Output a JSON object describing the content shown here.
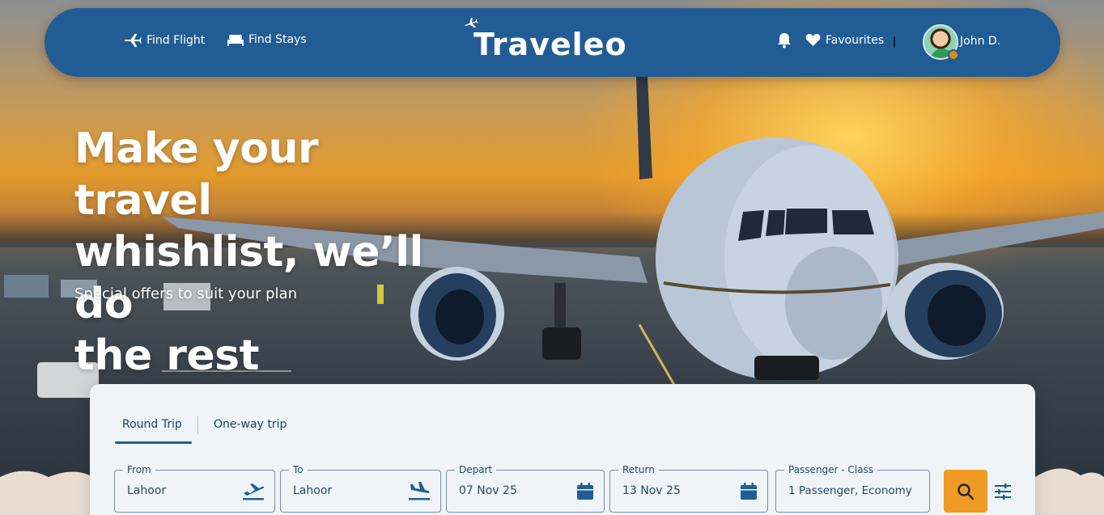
{
  "nav": {
    "find_flight": "Find Flight",
    "find_stays": "Find Stays",
    "logo": "Traveleo",
    "favourites": "Favourites",
    "user_name": "John D."
  },
  "hero": {
    "headline_line1": "Make your travel",
    "headline_line2": "whishlist, we’ll do",
    "headline_line3": "the rest",
    "subline": "Special offers to suit your plan"
  },
  "search": {
    "tabs": [
      {
        "label": "Round Trip",
        "active": true
      },
      {
        "label": "One-way trip",
        "active": false
      }
    ],
    "fields": [
      {
        "label": "From",
        "value": "Lahoor",
        "icon": "takeoff-icon"
      },
      {
        "label": "To",
        "value": "Lahoor",
        "icon": "landing-icon"
      },
      {
        "label": "Depart",
        "value": "07 Nov 25",
        "icon": "calendar-icon"
      },
      {
        "label": "Return",
        "value": "13 Nov 25",
        "icon": "calendar-icon"
      },
      {
        "label": "Passenger - Class",
        "value": "1 Passenger, Economy",
        "icon": ""
      }
    ],
    "search_icon": "search-icon",
    "filter_icon": "sliders-icon"
  },
  "colors": {
    "nav_bg": "#215d94",
    "accent": "#f09b26",
    "panel_bg": "#eef4f8",
    "text_dark": "#1b3f63"
  }
}
